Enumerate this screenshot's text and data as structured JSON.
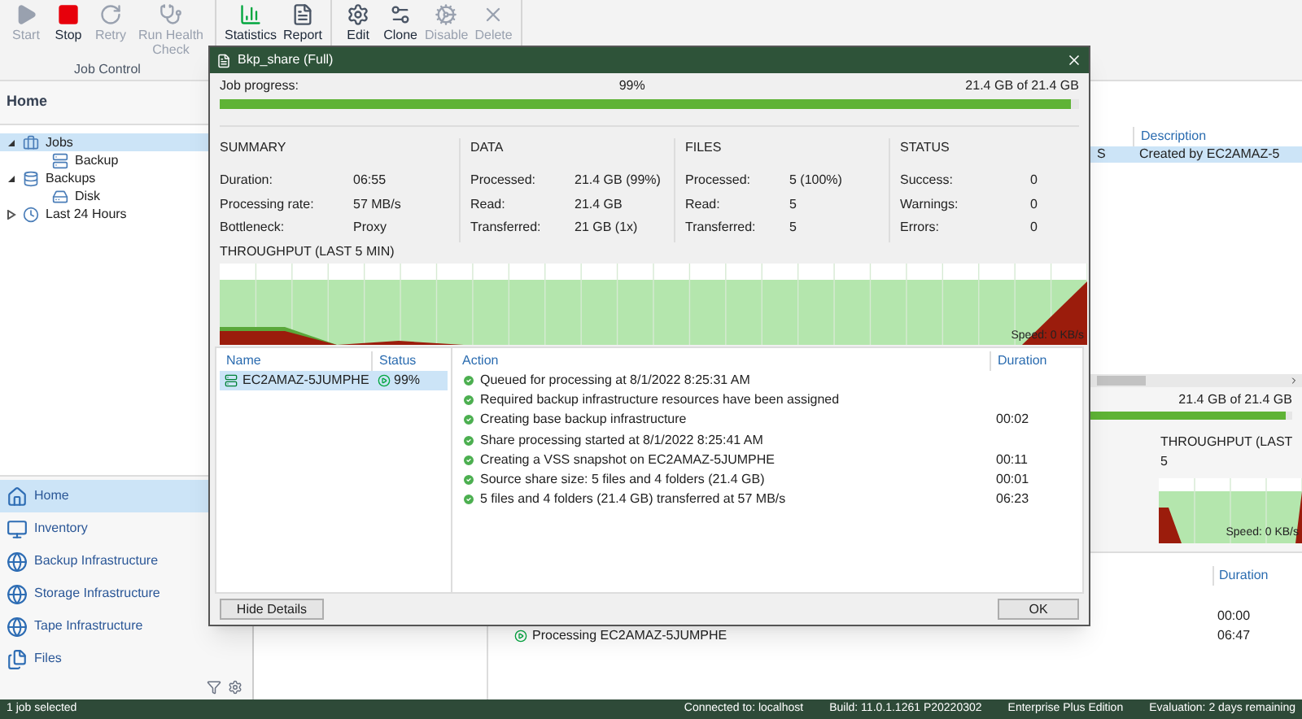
{
  "ribbon": {
    "groups": [
      {
        "label": "Job Control",
        "buttons": [
          {
            "label": "Start",
            "kind": "play",
            "disabled": true
          },
          {
            "label": "Stop",
            "kind": "stop",
            "disabled": false
          },
          {
            "label": "Retry",
            "kind": "retry",
            "disabled": true
          },
          {
            "label": "Run Health Check",
            "kind": "health",
            "disabled": true
          }
        ]
      },
      {
        "buttons": [
          {
            "label": "Statistics",
            "kind": "stats",
            "disabled": false
          },
          {
            "label": "Report",
            "kind": "report",
            "disabled": false
          }
        ]
      },
      {
        "buttons": [
          {
            "label": "Edit",
            "kind": "edit",
            "disabled": false
          },
          {
            "label": "Clone",
            "kind": "clone",
            "disabled": false
          },
          {
            "label": "Disable",
            "kind": "gear",
            "disabled": true
          },
          {
            "label": "Delete",
            "kind": "delete",
            "disabled": true
          }
        ]
      }
    ]
  },
  "sidebar": {
    "header": "Home",
    "tree": [
      {
        "label": "Jobs",
        "kind": "jobs",
        "selected": true,
        "expanded": true,
        "children": [
          {
            "label": "Backup",
            "kind": "job",
            "selected": false
          }
        ]
      },
      {
        "label": "Backups",
        "kind": "backups",
        "selected": false,
        "expanded": true,
        "children": [
          {
            "label": "Disk",
            "kind": "disk",
            "selected": false
          }
        ]
      },
      {
        "label": "Last 24 Hours",
        "kind": "history",
        "selected": false,
        "expanded": false
      }
    ],
    "nav": [
      {
        "label": "Home",
        "kind": "home",
        "selected": true
      },
      {
        "label": "Inventory",
        "kind": "inventory",
        "selected": false
      },
      {
        "label": "Backup Infrastructure",
        "kind": "globe",
        "selected": false
      },
      {
        "label": "Storage Infrastructure",
        "kind": "globe",
        "selected": false
      },
      {
        "label": "Tape Infrastructure",
        "kind": "tape",
        "selected": false
      },
      {
        "label": "Files",
        "kind": "files",
        "selected": false
      }
    ]
  },
  "jobs_table": {
    "description_header": "Description",
    "row": {
      "column_1": "S",
      "description": "Created by EC2AMAZ-5",
      "selected": true
    }
  },
  "session": {
    "amount": "21.4 GB of 21.4 GB",
    "level": 0.97,
    "throughput_title": "THROUGHPUT (LAST 5",
    "speed": "Speed: 0 KB/s",
    "duration_header": "Duration",
    "rows": [
      {
        "duration": "00:00"
      },
      {
        "text": "Processing EC2AMAZ-5JUMPHE",
        "duration": "06:47"
      }
    ]
  },
  "dialog": {
    "title": "Bkp_share (Full)",
    "progress": {
      "label": "Job progress:",
      "percent": "99%",
      "amount": "21.4 GB of 21.4 GB",
      "level": 0.99
    },
    "sections": [
      {
        "heading": "SUMMARY",
        "rows": [
          {
            "label": "Duration:",
            "value": "06:55"
          },
          {
            "label": "Processing rate:",
            "value": "57 MB/s"
          },
          {
            "label": "Bottleneck:",
            "value": "Proxy"
          }
        ]
      },
      {
        "heading": "DATA",
        "rows": [
          {
            "label": "Processed:",
            "value": "21.4 GB (99%)"
          },
          {
            "label": "Read:",
            "value": "21.4 GB"
          },
          {
            "label": "Transferred:",
            "value": "21 GB (1x)"
          }
        ]
      },
      {
        "heading": "FILES",
        "rows": [
          {
            "label": "Processed:",
            "value": "5 (100%)"
          },
          {
            "label": "Read:",
            "value": "5"
          },
          {
            "label": "Transferred:",
            "value": "5"
          }
        ]
      },
      {
        "heading": "STATUS",
        "rows": [
          {
            "label": "Success:",
            "value": "0"
          },
          {
            "label": "Warnings:",
            "value": "0"
          },
          {
            "label": "Errors:",
            "value": "0"
          }
        ]
      }
    ],
    "throughput": {
      "title": "THROUGHPUT (LAST 5 MIN)",
      "speed": "Speed: 0 KB/s"
    },
    "objects": {
      "columns": [
        "Name",
        "Status"
      ],
      "rows": [
        {
          "name": "EC2AMAZ-5JUMPHE",
          "status": "99%",
          "selected": true
        }
      ]
    },
    "actions": {
      "columns": [
        "Action",
        "Duration"
      ],
      "rows": [
        {
          "text": "Queued for processing at 8/1/2022 8:25:31 AM"
        },
        {
          "text": "Required backup infrastructure resources have been assigned"
        },
        {
          "text": "Creating base backup infrastructure",
          "duration": "00:02"
        },
        {
          "text": "Share processing started at 8/1/2022 8:25:41 AM"
        },
        {
          "text": "Creating a VSS snapshot on EC2AMAZ-5JUMPHE",
          "duration": "00:11"
        },
        {
          "text": "Source share size: 5 files and 4 folders (21.4 GB)",
          "duration": "00:01"
        },
        {
          "text": "5 files and 4 folders (21.4 GB) transferred at 57 MB/s",
          "duration": "06:23"
        }
      ]
    },
    "buttons": {
      "details": "Hide Details",
      "ok": "OK"
    }
  },
  "status_bar": [
    "1 job selected",
    "Connected to: localhost",
    "Build: 11.0.1.1261 P20220302",
    "Enterprise Plus Edition",
    "Evaluation: 2 days remaining"
  ]
}
